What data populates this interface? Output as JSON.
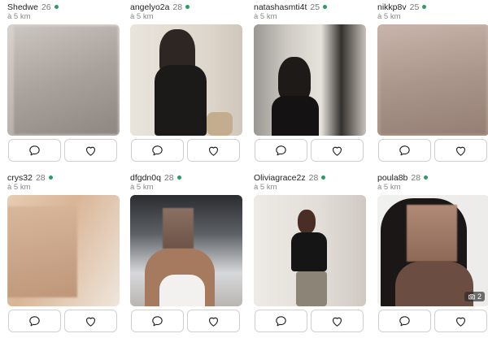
{
  "profiles": [
    {
      "name": "Shedwe",
      "age": "26",
      "distance": "à 5 km"
    },
    {
      "name": "angelyo2a",
      "age": "28",
      "distance": "à 5 km"
    },
    {
      "name": "natashasmti4t",
      "age": "25",
      "distance": "à 5 km"
    },
    {
      "name": "nikkp8v",
      "age": "25",
      "distance": "à 5 km"
    },
    {
      "name": "crys32",
      "age": "28",
      "distance": "à 5 km"
    },
    {
      "name": "dfgdn0q",
      "age": "28",
      "distance": "à 5 km"
    },
    {
      "name": "Oliviagrace2z",
      "age": "28",
      "distance": "à 5 km"
    },
    {
      "name": "poula8b",
      "age": "28",
      "distance": "à 5 km",
      "photo_count": "2"
    }
  ],
  "colors": {
    "online": "#2e9a68",
    "border": "#d0d0d0"
  },
  "icons": {
    "message": "chat-bubble-icon",
    "like": "heart-icon",
    "photos": "camera-icon"
  }
}
